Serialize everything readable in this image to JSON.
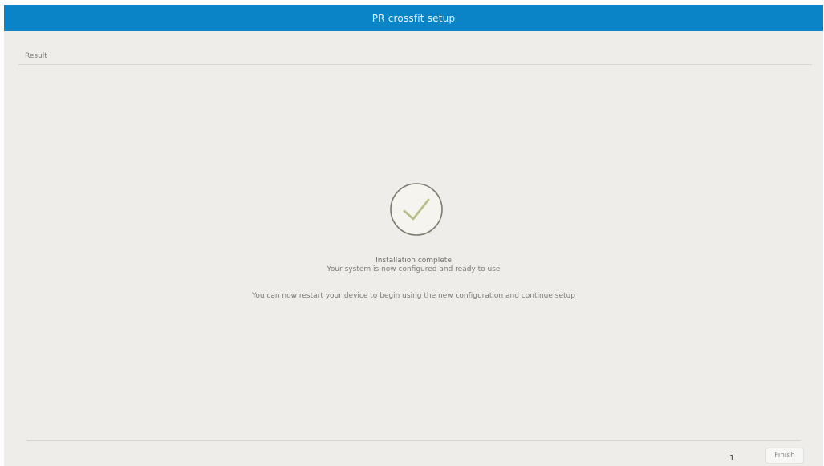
{
  "window": {
    "title": "PR crossfit setup"
  },
  "section": {
    "label": "Result"
  },
  "status": {
    "icon": "check-circle-icon",
    "title": "Installation complete",
    "subtitle": "Your system is now configured and ready to use",
    "note": "You can now restart your device to begin using the new configuration and continue setup"
  },
  "footer": {
    "page_indicator": "1",
    "finish_label": "Finish"
  },
  "colors": {
    "titlebar": "#0a84c7",
    "background": "#efedea",
    "icon_stroke": "#7c7b6f",
    "icon_check": "#b7c08b"
  }
}
